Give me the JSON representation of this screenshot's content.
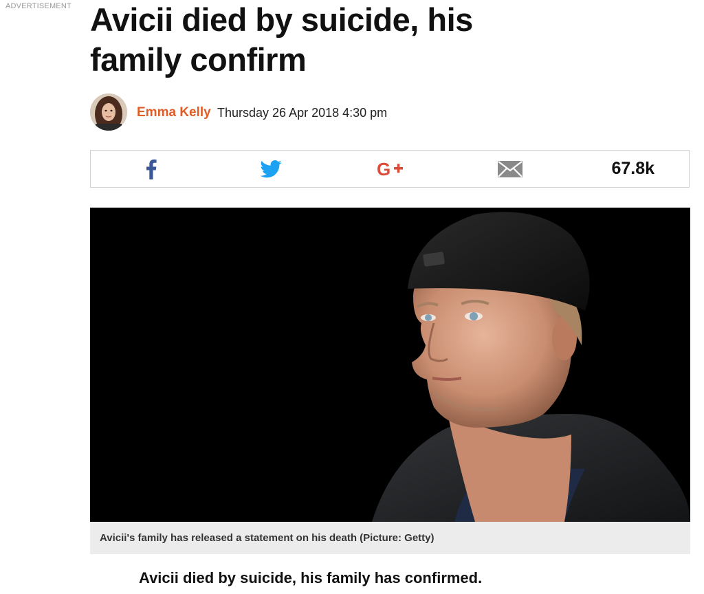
{
  "advertisement_label": "ADVERTISEMENT",
  "article": {
    "headline": "Avicii died by suicide, his family confirm",
    "author": "Emma Kelly",
    "date": "Thursday 26 Apr 2018 4:30 pm",
    "image_caption": "Avicii's family has released a statement on his death (Picture: Getty)",
    "lead": "Avicii died by suicide, his family has confirmed."
  },
  "share": {
    "items": [
      {
        "icon": "facebook-icon",
        "color": "#3b5998"
      },
      {
        "icon": "twitter-icon",
        "color": "#1da1f2"
      },
      {
        "icon": "google-plus-icon",
        "color": "#dd4b39"
      },
      {
        "icon": "email-icon",
        "color": "#8a8a8a"
      }
    ],
    "count": "67.8k"
  },
  "colors": {
    "author": "#e05d27",
    "caption_bg": "#ececec"
  }
}
